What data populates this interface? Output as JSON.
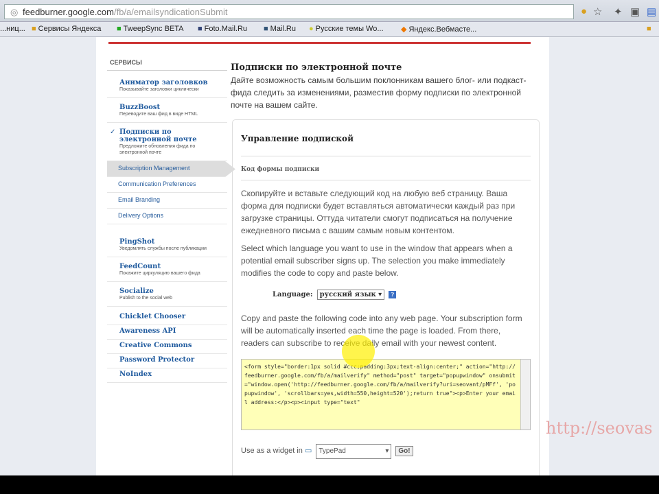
{
  "browser": {
    "url_host": "feedburner.google.com",
    "url_path": "/fb/a/emailsyndicationSubmit",
    "bookmarks": [
      "...ниц...",
      "Сервисы Яндекса",
      "TweepSync BETA",
      "Foto.Mail.Ru",
      "Mail.Ru",
      "Русские темы Wo...",
      "Яндекс.Вебмасте..."
    ]
  },
  "sidebar": {
    "heading": "СЕРВИСЫ",
    "services": [
      {
        "title": "Аниматор заголовков",
        "desc": "Показывайте заголовки циклически"
      },
      {
        "title": "BuzzBoost",
        "desc": "Переводите ваш фид в виде HTML"
      },
      {
        "title": "Подписки по электронной почте",
        "desc": "Предложите обновления фида по электронной почте",
        "checked": true
      }
    ],
    "sub_items": [
      "Subscription Management",
      "Communication Preferences",
      "Email Branding",
      "Delivery Options"
    ],
    "services2": [
      {
        "title": "PingShot",
        "desc": "Уведомлять службы после публикации"
      },
      {
        "title": "FeedCount",
        "desc": "Покажите циркуляцию вашего фида"
      },
      {
        "title": "Socialize",
        "desc": "Publish to the social web"
      }
    ],
    "links": [
      "Chicklet Chooser",
      "Awareness API",
      "Creative Commons",
      "Password Protector",
      "NoIndex"
    ]
  },
  "main": {
    "title": "Подписки по электронной почте",
    "intro": "Дайте возможность самым большим поклонникам вашего блог- или подкаст-фида следить за изменениями, разместив форму подписки по электронной почте на вашем сайте.",
    "box_title": "Управление подпиской",
    "section": "Код формы подписки",
    "p1": "Скопируйте и вставьте следующий код на любую веб страницу. Ваша форма для подписки будет вставляться автоматически каждый раз при загрузке страницы. Оттуда читатели смогут подписаться на получение ежедневного письма с вашим самым новым контентом.",
    "p2": "Select which language you want to use in the window that appears when a potential email subscriber signs up. The selection you make immediately modifies the code to copy and paste below.",
    "language_label": "Language:",
    "language_value": "русский язык",
    "p3": "Copy and paste the following code into any web page. Your subscription form will be automatically inserted each time the page is loaded. From there, readers can subscribe to receive daily email with your newest content.",
    "code": "<form style=\"border:1px solid #ccc;padding:3px;text-align:center;\" action=\"http://feedburner.google.com/fb/a/mailverify\" method=\"post\" target=\"popupwindow\" onsubmit=\"window.open('http://feedburner.google.com/fb/a/mailverify?uri=seovant/pMFf', 'popupwindow', 'scrollbars=yes,width=550,height=520');return true\"><p>Enter your email address:</p><p><input type=\"text\"",
    "widget_label": "Use as a widget in",
    "widget_value": "TypePad",
    "go": "Go!"
  },
  "watermark": "http://seovas"
}
